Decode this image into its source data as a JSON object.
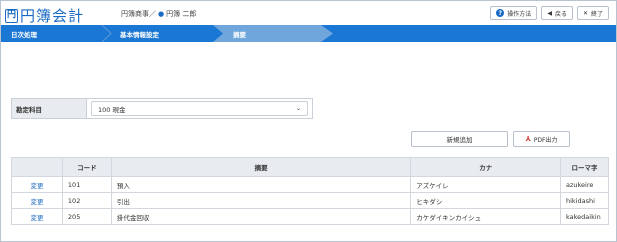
{
  "app": {
    "logo_char": "円",
    "title": "円簿会計"
  },
  "company": {
    "name": "円簿商事",
    "separator": "／",
    "user": "円簿 二郎"
  },
  "header_buttons": [
    {
      "label": "操作方法",
      "icon": "help-icon"
    },
    {
      "label": "戻る",
      "icon": "arrow-left-icon"
    },
    {
      "label": "終了",
      "icon": "close-icon"
    }
  ],
  "breadcrumb": [
    "日次処理",
    "基本情報設定",
    "摘要"
  ],
  "form": {
    "label": "勘定科目",
    "selected": "100 現金"
  },
  "actions": {
    "new": "新規追加",
    "pdf": "PDF出力"
  },
  "table": {
    "headers": [
      "",
      "コード",
      "摘要",
      "カナ",
      "ローマ字"
    ],
    "rows": [
      {
        "edit": "変更",
        "code": "101",
        "desc": "預入",
        "kana": "アズケイレ",
        "roma": "azukeire"
      },
      {
        "edit": "変更",
        "code": "102",
        "desc": "引出",
        "kana": "ヒキダシ",
        "roma": "hikidashi"
      },
      {
        "edit": "変更",
        "code": "205",
        "desc": "掛代金回収",
        "kana": "カケダイキンカイシュ",
        "roma": "kakedaikin"
      }
    ]
  },
  "colors": {
    "brand": "#1a6bc4",
    "bar": "#1b77d4",
    "current_step": "#6fa6dc"
  }
}
